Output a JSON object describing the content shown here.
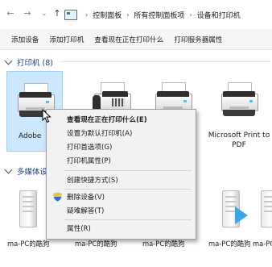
{
  "nav": {
    "back_icon": "arrow-left-icon",
    "forward_icon": "arrow-right-icon",
    "recent_icon": "chevron-down-icon",
    "up_icon": "arrow-up-icon"
  },
  "breadcrumb": [
    "控制面板",
    "所有控制面板项",
    "设备和打印机"
  ],
  "commands": [
    "添加设备",
    "添加打印机",
    "查看现在正在打印什么",
    "打印服务器属性"
  ],
  "printers_group": {
    "title": "打印机 (8)"
  },
  "printers": [
    {
      "name": "Adobe",
      "icon": "printer-icon",
      "selected": true
    },
    {
      "name": "",
      "icon": "fax-icon",
      "selected": false
    },
    {
      "name": "",
      "icon": "printer-icon",
      "selected": false
    },
    {
      "name": "Microsoft Print to PDF",
      "icon": "printer-icon",
      "selected": false
    }
  ],
  "media_group": {
    "title": "多媒体设"
  },
  "media_devices": [
    "ma-PC的酷狗",
    "ma-PC的酷狗",
    "ma-PC的酷狗",
    "ma-PC的酷狗",
    "ma-PC的酷狗"
  ],
  "context_menu": {
    "items": [
      {
        "label": "查看现在正在打印什么(E)",
        "bold": true
      },
      {
        "label": "设置为默认打印机(A)"
      },
      {
        "label": "打印首选项(G)"
      },
      {
        "label": "打印机属性(P)"
      },
      {
        "label": "创建快捷方式(S)"
      },
      {
        "label": "删除设备(V)",
        "icon": "shield-icon"
      },
      {
        "label": "疑难解答(T)"
      },
      {
        "label": "属性(R)"
      }
    ]
  },
  "colors": {
    "selection": "#cce8ff",
    "group_header": "#1e3f8a",
    "menu_bg": "#f2f2f2",
    "play_accent": "#3aa7e6"
  }
}
